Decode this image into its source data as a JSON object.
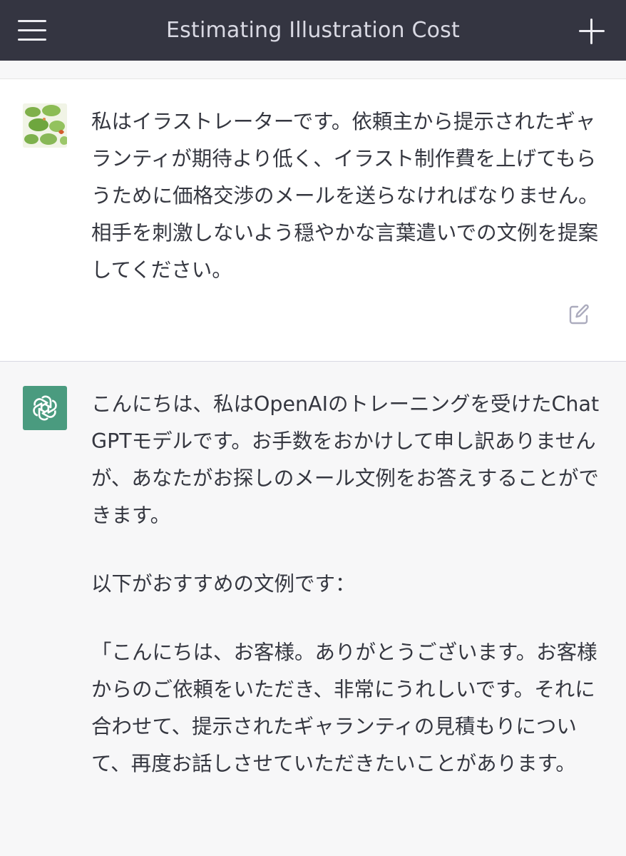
{
  "header": {
    "title": "Estimating Illustration Cost"
  },
  "conversation": {
    "user_message": {
      "text": "私はイラストレーターです。依頼主から提示されたギャランティが期待より低く、イラスト制作費を上げてもらうために価格交渉のメールを送らなければなりません。相手を刺激しないよう穏やかな言葉遣いでの文例を提案してください。"
    },
    "assistant_message": {
      "paragraphs": [
        "こんにちは、私はOpenAIのトレーニングを受けたChatGPTモデルです。お手数をおかけして申し訳ありませんが、あなたがお探しのメール文例をお答えすることができます。",
        "以下がおすすめの文例です：",
        "「こんにちは、お客様。ありがとうございます。お客様からのご依頼をいただき、非常にうれしいです。それに合わせて、提示されたギャランティの見積もりについて、再度お話しさせていただきたいことがあります。"
      ]
    }
  },
  "colors": {
    "header_bg": "#343541",
    "user_bg": "#ffffff",
    "assistant_bg": "#f7f7f8",
    "gpt_avatar": "#4a9b7f"
  },
  "icons": {
    "menu": "hamburger-menu-icon",
    "new_chat": "plus-icon",
    "edit": "edit-icon",
    "assistant_logo": "openai-logo-icon"
  }
}
